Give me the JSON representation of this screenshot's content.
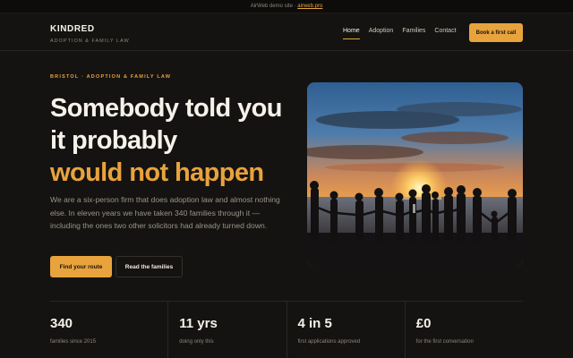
{
  "topbar": {
    "text": "AirWeb demo site · ",
    "link": "airweb.pro"
  },
  "brand": {
    "name": "KINDRED",
    "tagline": "ADOPTION & FAMILY LAW"
  },
  "nav": {
    "items": [
      {
        "label": "Home",
        "active": true
      },
      {
        "label": "Adoption",
        "active": false
      },
      {
        "label": "Families",
        "active": false
      },
      {
        "label": "Contact",
        "active": false
      }
    ],
    "cta": "Book a first call"
  },
  "hero": {
    "eyebrow": "BRISTOL · ADOPTION & FAMILY LAW",
    "headline_line1": "Somebody told you",
    "headline_line2": "it probably",
    "headline_accent": "would not happen",
    "lead": "We are a six-person firm that does adoption law and almost nothing else. In eleven years we have taken 340 families through it — including the ones two other solicitors had already turned down.",
    "primary_button": "Find your route",
    "secondary_button": "Read the families"
  },
  "stats": [
    {
      "value": "340",
      "label": "families since 2015"
    },
    {
      "value": "11 yrs",
      "label": "doing only this"
    },
    {
      "value": "4 in 5",
      "label": "first applications approved"
    },
    {
      "value": "£0",
      "label": "for the first conversation"
    }
  ],
  "colors": {
    "accent": "#e8a33d",
    "background": "#151311",
    "text": "#f6f2ea",
    "muted": "#8d857a"
  }
}
